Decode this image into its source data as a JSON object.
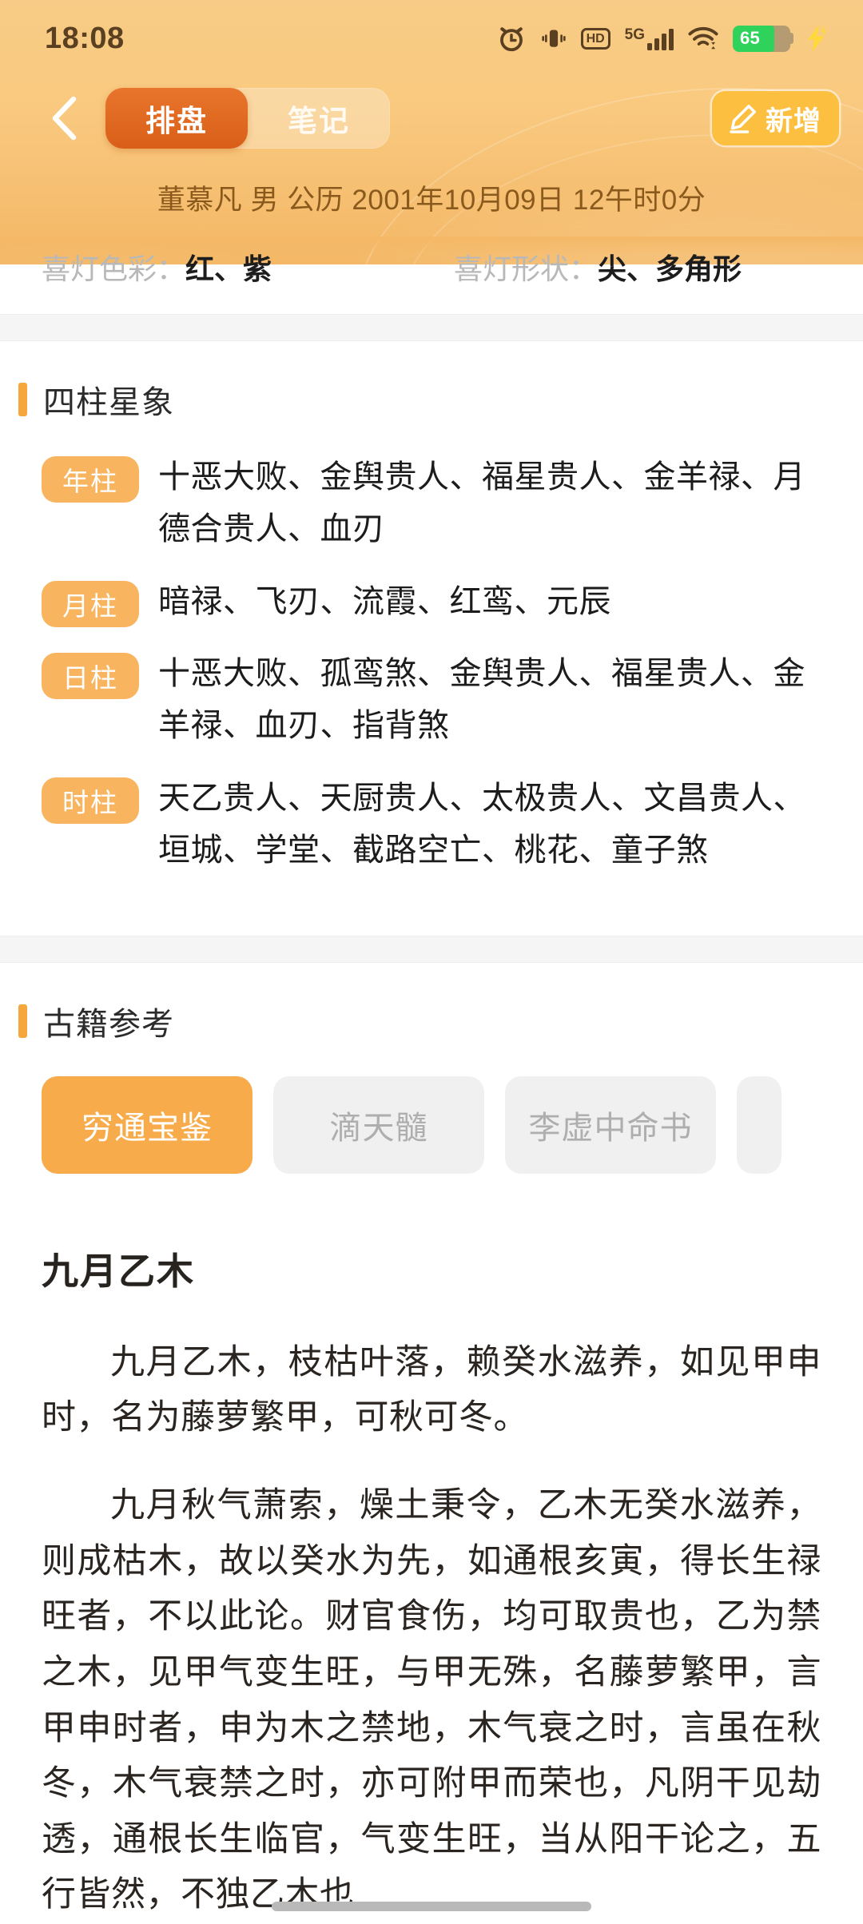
{
  "statusbar": {
    "time": "18:08",
    "battery_percent": "65",
    "hd_label": "HD",
    "network_label": "5G",
    "icons": [
      "alarm-clock-icon",
      "vibrate-icon",
      "hd-icon",
      "signal-5g-icon",
      "wifi-icon",
      "battery-icon",
      "charging-bolt-icon"
    ]
  },
  "header": {
    "back_icon": "chevron-left-icon",
    "tabs": [
      {
        "label": "排盘",
        "active": true
      },
      {
        "label": "笔记",
        "active": false
      }
    ],
    "add_button": {
      "label": "新增",
      "icon": "pencil-icon"
    },
    "subtitle": {
      "name": "董慕凡",
      "gender": "男",
      "calendar": "公历",
      "datetime": "2001年10月09日 12午时0分",
      "full": "董慕凡 男 公历 2001年10月09日 12午时0分"
    }
  },
  "peek": [
    {
      "key": "喜灯色彩：",
      "value": "红、紫"
    },
    {
      "key": "喜灯形状：",
      "value": "尖、多角形"
    }
  ],
  "sections": {
    "sizhu": {
      "title": "四柱星象",
      "rows": [
        {
          "chip": "年柱",
          "text": "十恶大败、金舆贵人、福星贵人、金羊禄、月德合贵人、血刃"
        },
        {
          "chip": "月柱",
          "text": "暗禄、飞刃、流霞、红鸾、元辰"
        },
        {
          "chip": "日柱",
          "text": "十恶大败、孤鸾煞、金舆贵人、福星贵人、金羊禄、血刃、指背煞"
        },
        {
          "chip": "时柱",
          "text": "天乙贵人、天厨贵人、太极贵人、文昌贵人、垣城、学堂、截路空亡、桃花、童子煞"
        }
      ]
    },
    "guji": {
      "title": "古籍参考",
      "tabs": [
        {
          "label": "穷通宝鉴",
          "active": true
        },
        {
          "label": "滴天髓",
          "active": false
        },
        {
          "label": "李虚中命书",
          "active": false
        },
        {
          "label": "",
          "active": false,
          "partial": true
        }
      ],
      "article": {
        "heading": "九月乙木",
        "paragraphs": [
          "九月乙木，枝枯叶落，赖癸水滋养，如见甲申时，名为藤萝繁甲，可秋可冬。",
          "九月秋气萧索，燥土秉令，乙木无癸水滋养，则成枯木，故以癸水为先，如通根亥寅，得长生禄旺者，不以此论。财官食伤，均可取贵也，乙为禁之木，见甲气变生旺，与甲无殊，名藤萝繁甲，言甲申时者，申为木之禁地，木气衰之时，言虽在秋冬，木气衰禁之时，亦可附甲而荣也，凡阴干见劫透，通根长生临官，气变生旺，当从阳干论之，五行皆然，不独乙木也"
        ]
      }
    }
  },
  "colors": {
    "accent": "#f5a63c",
    "accent_active": "#f7ab4a",
    "tab_active": "#d95f18",
    "add_button": "#fcbf3f",
    "header_top": "#f8cc86",
    "header_bottom": "#f4b866",
    "battery_green": "#2fd35c",
    "muted_text": "#aeaeae"
  }
}
